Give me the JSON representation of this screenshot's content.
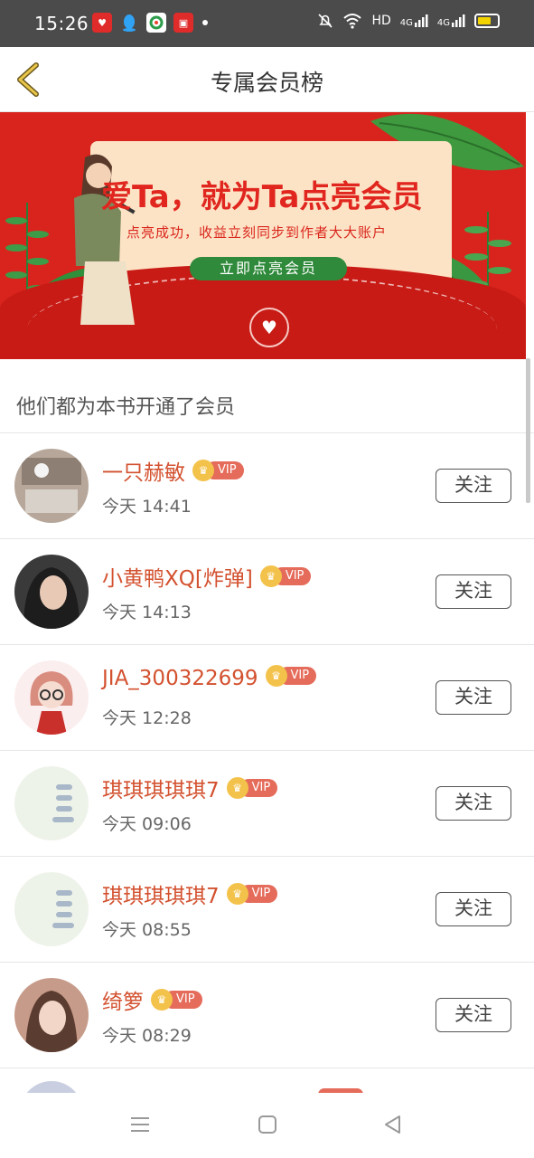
{
  "status_bar": {
    "time": "15:26",
    "network": "HD",
    "signal1": "4G",
    "signal2": "4G",
    "icons": [
      "alarm-off-icon",
      "wifi-icon",
      "battery-icon"
    ]
  },
  "header": {
    "back_icon": "chevron-left-icon",
    "title": "专属会员榜"
  },
  "banner": {
    "headline": "爱Ta，就为Ta点亮会员",
    "subtitle": "点亮成功，收益立刻同步到作者大大账户",
    "cta": "立即点亮会员"
  },
  "section": {
    "title": "他们都为本书开通了会员"
  },
  "members": [
    {
      "name": "一只赫敏",
      "badge": "VIP",
      "time": "今天 14:41",
      "follow": "关注",
      "avatar_color": "#b7a79a"
    },
    {
      "name": "小黄鸭XQ[炸弹]",
      "badge": "VIP",
      "time": "今天 14:13",
      "follow": "关注",
      "avatar_color": "#3a3a3a"
    },
    {
      "name": "JIA_300322699",
      "badge": "VIP",
      "time": "今天 12:28",
      "follow": "关注",
      "avatar_color": "#f2d6d3"
    },
    {
      "name": "琪琪琪琪琪7",
      "badge": "VIP",
      "time": "今天 09:06",
      "follow": "关注",
      "avatar_color": "#eef3ea"
    },
    {
      "name": "琪琪琪琪琪7",
      "badge": "VIP",
      "time": "今天 08:55",
      "follow": "关注",
      "avatar_color": "#eef3ea"
    },
    {
      "name": "绮箩",
      "badge": "VIP",
      "time": "今天 08:29",
      "follow": "关注",
      "avatar_color": "#c79b8a"
    }
  ],
  "system_nav": {
    "icons": [
      "menu-icon",
      "home-square-icon",
      "back-triangle-icon"
    ]
  },
  "colors": {
    "accent": "#d3512f",
    "banner_red": "#d8241d",
    "vip_tag": "#e56b5a",
    "crown": "#f3c24a"
  }
}
